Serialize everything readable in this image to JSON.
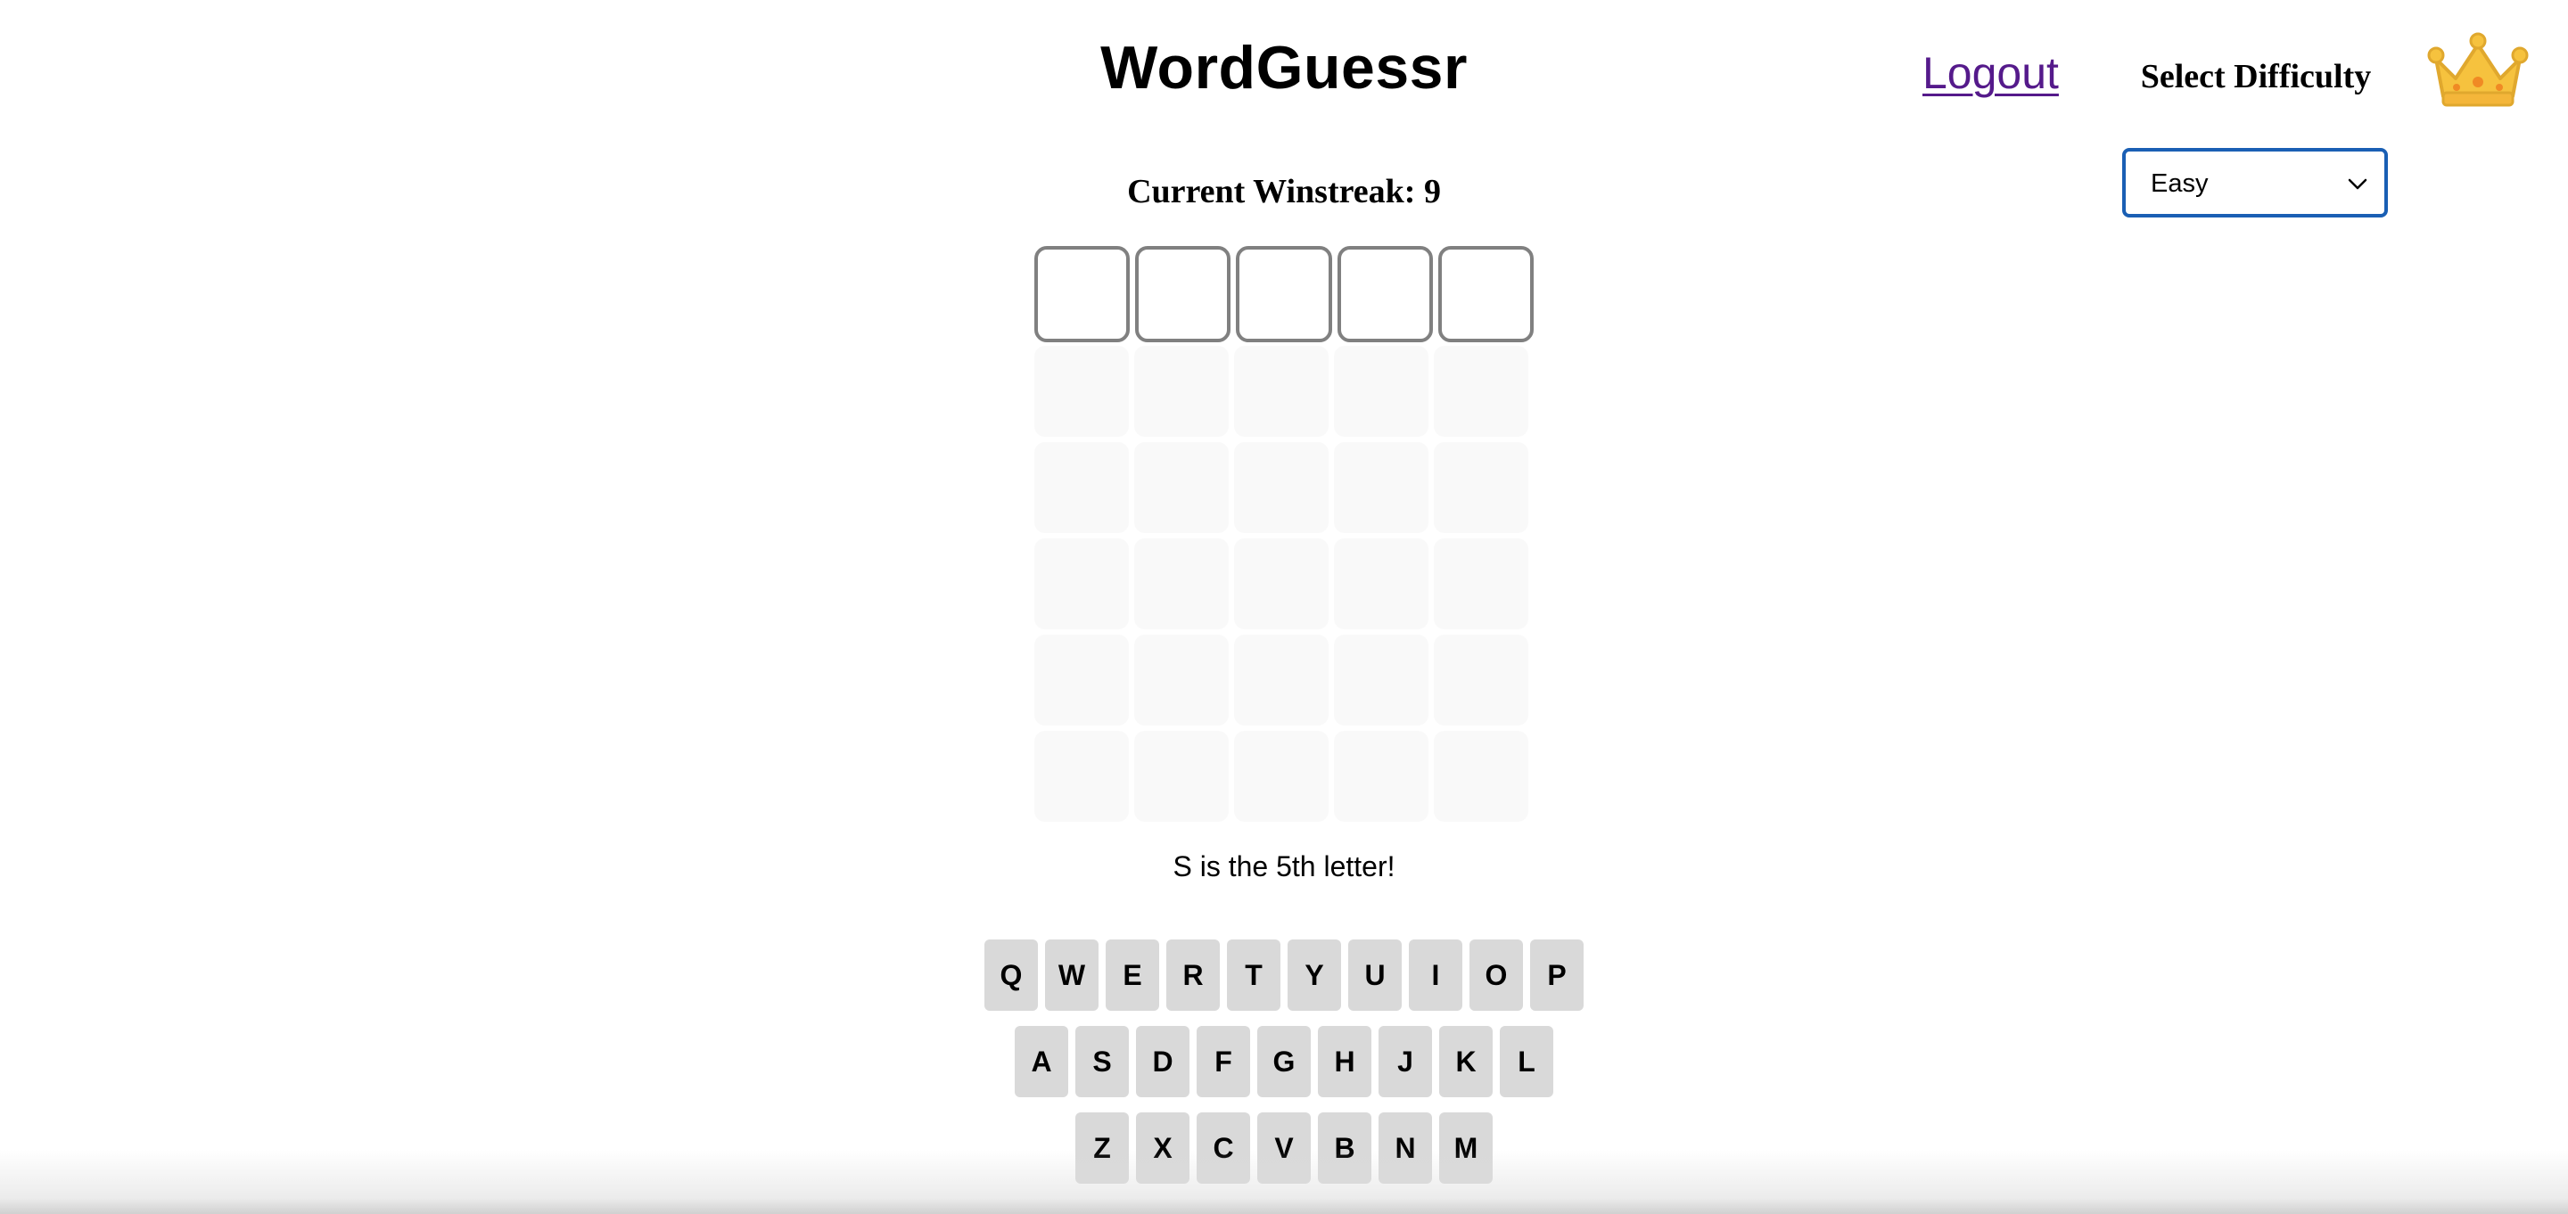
{
  "header": {
    "title": "WordGuessr",
    "logout_label": "Logout",
    "difficulty_label": "Select Difficulty",
    "difficulty_selected": "Easy",
    "crown_icon": "crown-icon"
  },
  "status": {
    "winstreak_label": "Current Winstreak:",
    "winstreak_value": "9"
  },
  "board": {
    "rows": 6,
    "columns": 5,
    "active_row": 1,
    "letters": [
      [
        "",
        "",
        "",
        "",
        ""
      ],
      [
        "",
        "",
        "",
        "",
        ""
      ],
      [
        "",
        "",
        "",
        "",
        ""
      ],
      [
        "",
        "",
        "",
        "",
        ""
      ],
      [
        "",
        "",
        "",
        "",
        ""
      ],
      [
        "",
        "",
        "",
        "",
        ""
      ]
    ]
  },
  "hint": {
    "message": "S is the 5th letter!"
  },
  "keyboard": {
    "rows": [
      [
        "Q",
        "W",
        "E",
        "R",
        "T",
        "Y",
        "U",
        "I",
        "O",
        "P"
      ],
      [
        "A",
        "S",
        "D",
        "F",
        "G",
        "H",
        "J",
        "K",
        "L"
      ],
      [
        "Z",
        "X",
        "C",
        "V",
        "B",
        "N",
        "M"
      ]
    ]
  },
  "colors": {
    "link": "#551a8b",
    "select_border": "#1a5fb4",
    "key_bg": "#d9d9d9",
    "active_tile_border": "#808080",
    "empty_tile_bg": "#f9f9f9",
    "crown": "#f6c23e"
  }
}
